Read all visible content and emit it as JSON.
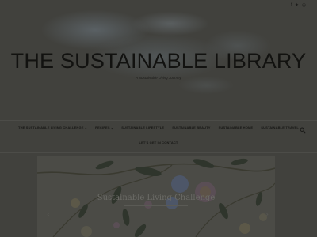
{
  "social": {
    "facebook_icon": "f",
    "twitter_icon": "✦",
    "instagram_icon": "◎"
  },
  "header": {
    "title": "THE SUSTAINABLE LIBRARY",
    "tagline": "A Sustainable Living Journey"
  },
  "nav": {
    "items": [
      {
        "label": "THE SUSTAINABLE LIVING CHALLENGE",
        "dropdown": true
      },
      {
        "label": "RECIPES",
        "dropdown": true
      },
      {
        "label": "SUSTAINABLE LIFESTYLE",
        "dropdown": false
      },
      {
        "label": "SUSTAINABLE BEAUTY",
        "dropdown": false
      },
      {
        "label": "SUSTAINABLE HOME",
        "dropdown": false
      },
      {
        "label": "SUSTAINABLE TRAVEL",
        "dropdown": false
      }
    ],
    "second_row": [
      {
        "label": "LET'S GET IN CONTACT",
        "dropdown": false
      }
    ],
    "caret": "⌄",
    "search_icon": "search-icon"
  },
  "slider": {
    "caption": "Sustainable Living Challenge",
    "prev_arrow": "‹",
    "next_arrow": "›"
  },
  "colors": {
    "overlay": "#41413d",
    "text": "#121210"
  }
}
